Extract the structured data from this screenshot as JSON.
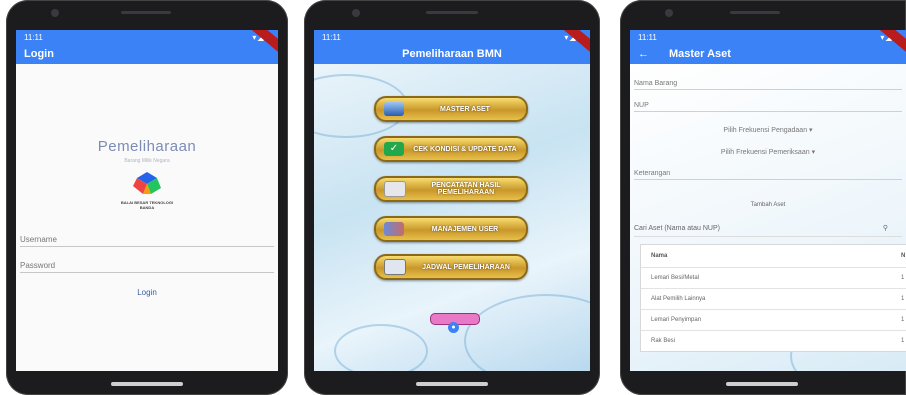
{
  "phones": [
    {
      "status_time": "11:11",
      "app_title": "Login",
      "app_name": "Pemeliharaan",
      "app_subtitle": "Barang Milik Negara",
      "org_name": "BALAI BESAR TEKNOLOGI",
      "org_sub": "BANDA",
      "username_placeholder": "Username",
      "password_placeholder": "Password",
      "login_label": "Login"
    },
    {
      "status_time": "11:11",
      "app_title": "Pemeliharaan BMN",
      "menu": [
        {
          "label": "MASTER ASET",
          "icon": "database-icon"
        },
        {
          "label": "CEK KONDISI & UPDATE DATA",
          "icon": "checkmark-icon"
        },
        {
          "label": "PENCATATAN HASIL PEMELIHARAAN",
          "icon": "notes-icon"
        },
        {
          "label": "MANAJEMEN USER",
          "icon": "users-icon"
        },
        {
          "label": "JADWAL PEMELIHARAAN",
          "icon": "calendar-icon"
        }
      ],
      "footer_icon": "person-icon"
    },
    {
      "status_time": "11:11",
      "app_title": "Master Aset",
      "fields": {
        "nama_barang": "Nama Barang",
        "nup": "NUP",
        "pengadaan_dropdown": "Pilih Frekuensi Pengadaan",
        "pemeriksaan_dropdown": "Pilih Frekuensi Pemeriksaan",
        "keterangan": "Keterangan"
      },
      "add_label": "Tambah Aset",
      "search_placeholder": "Cari Aset (Nama atau NUP)",
      "table": {
        "headers": [
          "Nama",
          "N"
        ],
        "rows": [
          [
            "Lemari Besi/Metal",
            "1"
          ],
          [
            "Alat Pemilih Lainnya",
            "1"
          ],
          [
            "Lemari Penyimpan",
            "1"
          ],
          [
            "Rak Besi",
            "1"
          ]
        ]
      }
    }
  ],
  "colors": {
    "app_bar": "#3b82f6",
    "gold_button": "#d4a83a",
    "debug_ribbon": "#b91c1c"
  }
}
